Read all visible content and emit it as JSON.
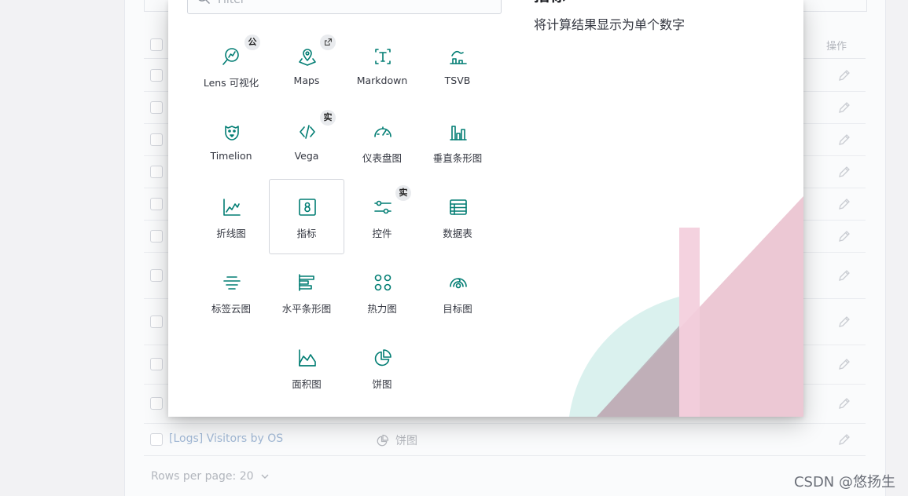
{
  "modal": {
    "filter_placeholder": "Filter",
    "description_title": "指标",
    "description_text": "将计算结果显示为单个数字",
    "tiles": [
      {
        "label": "Lens 可视化",
        "icon": "lens-icon",
        "badge": "公"
      },
      {
        "label": "Maps",
        "icon": "maps-icon",
        "badge_icon": "external-link-icon"
      },
      {
        "label": "Markdown",
        "icon": "markdown-icon"
      },
      {
        "label": "TSVB",
        "icon": "tsvb-icon"
      },
      {
        "label": "Timelion",
        "icon": "timelion-icon"
      },
      {
        "label": "Vega",
        "icon": "vega-code-icon",
        "badge": "实"
      },
      {
        "label": "仪表盘图",
        "icon": "gauge-icon"
      },
      {
        "label": "垂直条形图",
        "icon": "vertical-bar-icon"
      },
      {
        "label": "折线图",
        "icon": "line-chart-icon"
      },
      {
        "label": "指标",
        "icon": "metric-icon",
        "selected": true
      },
      {
        "label": "控件",
        "icon": "controls-icon",
        "badge": "实"
      },
      {
        "label": "数据表",
        "icon": "data-table-icon"
      },
      {
        "label": "标签云图",
        "icon": "tag-cloud-icon"
      },
      {
        "label": "水平条形图",
        "icon": "horizontal-bar-icon"
      },
      {
        "label": "热力图",
        "icon": "heatmap-icon"
      },
      {
        "label": "目标图",
        "icon": "goal-icon"
      },
      {
        "label": "面积图",
        "icon": "area-chart-icon"
      },
      {
        "label": "饼图",
        "icon": "pie-chart-icon"
      }
    ]
  },
  "background": {
    "actions_header": "操作",
    "visible_row": {
      "name": "[Logs] Visitors by OS",
      "type": "饼图"
    },
    "rows_per_page_label": "Rows per page: 20",
    "watermark": "CSDN @悠扬生"
  },
  "colors": {
    "accent": "#017d73",
    "badge_bg": "#e9ebee"
  }
}
